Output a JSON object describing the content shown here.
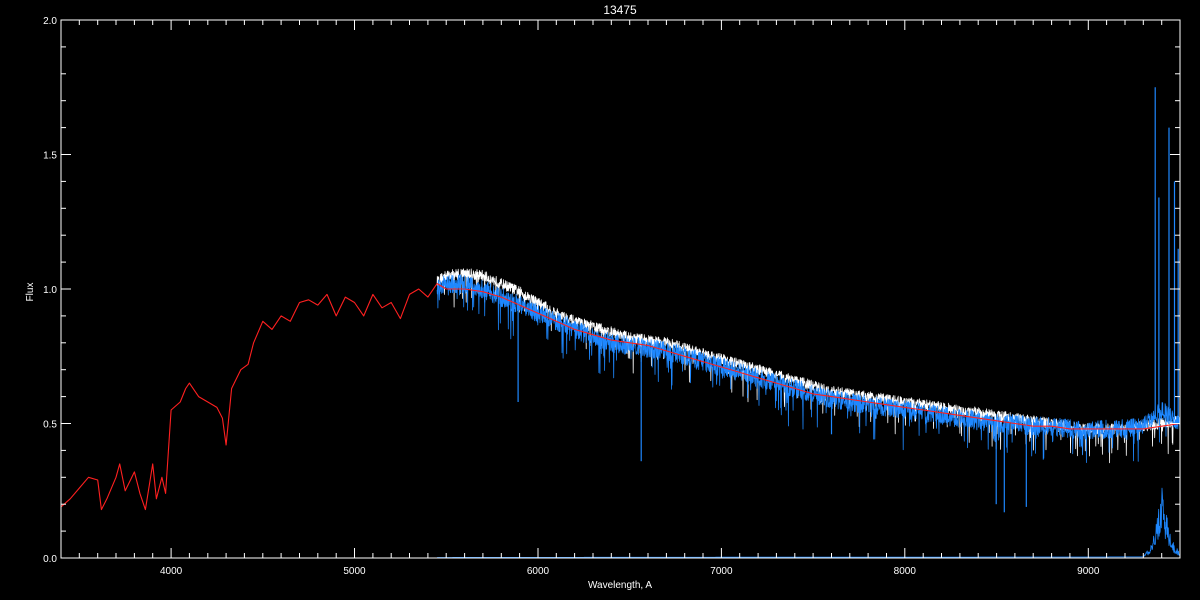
{
  "chart_data": {
    "type": "line",
    "title": "13475",
    "xlabel": "Wavelength, A",
    "ylabel": "Flux",
    "xlim": [
      3400,
      9500
    ],
    "ylim": [
      0.0,
      2.0
    ],
    "x_major_ticks": [
      4000,
      5000,
      6000,
      7000,
      8000,
      9000
    ],
    "x_minor_step": 100,
    "y_major_ticks": [
      0.0,
      0.5,
      1.0,
      1.5,
      2.0
    ],
    "y_minor_step": 0.1,
    "x_tick_labels": [
      "4000",
      "5000",
      "6000",
      "7000",
      "8000",
      "9000"
    ],
    "y_tick_labels": [
      "0.0",
      "0.5",
      "1.0",
      "1.5",
      "2.0"
    ],
    "grid": false,
    "background": "#000000",
    "axis_color": "#ffffff",
    "series": [
      {
        "color": "#ffffff",
        "style": "noisy",
        "noise": 0.02,
        "x": [
          5450,
          5500,
          5600,
          5700,
          5800,
          5900,
          6000,
          6100,
          6200,
          6300,
          6400,
          6500,
          6600,
          6700,
          6800,
          6900,
          7000,
          7100,
          7200,
          7300,
          7400,
          7500,
          7600,
          7700,
          7800,
          7900,
          8000,
          8100,
          8200,
          8300,
          8400,
          8500,
          8600,
          8700,
          8800,
          8900,
          9000,
          9100,
          9200,
          9300,
          9400,
          9500
        ],
        "y": [
          1.03,
          1.05,
          1.06,
          1.05,
          1.02,
          0.99,
          0.95,
          0.91,
          0.88,
          0.86,
          0.84,
          0.82,
          0.81,
          0.8,
          0.78,
          0.76,
          0.74,
          0.72,
          0.7,
          0.68,
          0.66,
          0.64,
          0.62,
          0.61,
          0.6,
          0.59,
          0.58,
          0.57,
          0.56,
          0.55,
          0.54,
          0.53,
          0.52,
          0.51,
          0.5,
          0.49,
          0.48,
          0.48,
          0.48,
          0.49,
          0.5,
          0.51
        ]
      },
      {
        "color": "#1e88ff",
        "style": "noisy",
        "noise": 0.035,
        "x": [
          5450,
          5500,
          5600,
          5700,
          5800,
          5900,
          6000,
          6100,
          6200,
          6300,
          6400,
          6500,
          6600,
          6700,
          6800,
          6900,
          7000,
          7100,
          7200,
          7300,
          7400,
          7500,
          7600,
          7700,
          7800,
          7900,
          8000,
          8100,
          8200,
          8300,
          8400,
          8500,
          8600,
          8700,
          8800,
          8900,
          9000,
          9100,
          9200,
          9300,
          9400,
          9500
        ],
        "y": [
          1.0,
          1.02,
          1.02,
          1.0,
          0.97,
          0.94,
          0.91,
          0.88,
          0.85,
          0.82,
          0.8,
          0.79,
          0.78,
          0.77,
          0.75,
          0.73,
          0.71,
          0.69,
          0.67,
          0.65,
          0.63,
          0.61,
          0.59,
          0.58,
          0.57,
          0.56,
          0.55,
          0.54,
          0.53,
          0.52,
          0.51,
          0.5,
          0.5,
          0.49,
          0.49,
          0.48,
          0.47,
          0.48,
          0.48,
          0.49,
          0.55,
          0.5
        ]
      },
      {
        "color": "#ff2020",
        "style": "line",
        "x": [
          3400,
          3450,
          3500,
          3550,
          3600,
          3620,
          3650,
          3700,
          3720,
          3750,
          3800,
          3830,
          3860,
          3900,
          3920,
          3950,
          3970,
          4000,
          4050,
          4080,
          4100,
          4150,
          4200,
          4250,
          4280,
          4300,
          4330,
          4380,
          4420,
          4450,
          4500,
          4550,
          4600,
          4650,
          4700,
          4750,
          4800,
          4850,
          4900,
          4950,
          5000,
          5050,
          5100,
          5150,
          5200,
          5250,
          5300,
          5350,
          5400,
          5450,
          5500,
          5600,
          5700,
          5800,
          5900,
          6000,
          6100,
          6200,
          6300,
          6400,
          6500,
          6600,
          6700,
          6800,
          6900,
          7000,
          7100,
          7200,
          7300,
          7400,
          7500,
          7600,
          7700,
          7800,
          7900,
          8000,
          8100,
          8200,
          8300,
          8400,
          8500,
          8600,
          8700,
          8800,
          8900,
          9000,
          9100,
          9200,
          9300,
          9400,
          9500
        ],
        "y": [
          0.19,
          0.22,
          0.26,
          0.3,
          0.29,
          0.18,
          0.22,
          0.3,
          0.35,
          0.25,
          0.32,
          0.24,
          0.18,
          0.35,
          0.22,
          0.3,
          0.24,
          0.55,
          0.58,
          0.63,
          0.65,
          0.6,
          0.58,
          0.56,
          0.52,
          0.42,
          0.63,
          0.7,
          0.72,
          0.8,
          0.88,
          0.85,
          0.9,
          0.88,
          0.95,
          0.96,
          0.94,
          0.98,
          0.9,
          0.97,
          0.95,
          0.9,
          0.98,
          0.93,
          0.95,
          0.89,
          0.98,
          1.0,
          0.97,
          1.02,
          1.0,
          1.0,
          0.99,
          0.97,
          0.94,
          0.91,
          0.88,
          0.85,
          0.83,
          0.81,
          0.8,
          0.79,
          0.77,
          0.75,
          0.73,
          0.71,
          0.69,
          0.67,
          0.65,
          0.63,
          0.61,
          0.6,
          0.59,
          0.58,
          0.57,
          0.56,
          0.55,
          0.54,
          0.53,
          0.52,
          0.51,
          0.5,
          0.49,
          0.49,
          0.48,
          0.48,
          0.48,
          0.48,
          0.48,
          0.49,
          0.5
        ]
      },
      {
        "color": "#1e88ff",
        "style": "baseline",
        "x": [
          5450,
          9300,
          9350,
          9400,
          9450,
          9500
        ],
        "y": [
          0.002,
          0.004,
          0.03,
          0.15,
          0.04,
          0.01
        ]
      }
    ],
    "spikes": [
      {
        "x": 5892,
        "y": 0.58,
        "color": "#1e88ff"
      },
      {
        "x": 6563,
        "y": 0.36,
        "color": "#1e88ff"
      },
      {
        "x": 8498,
        "y": 0.2,
        "color": "#1e88ff"
      },
      {
        "x": 8542,
        "y": 0.17,
        "color": "#1e88ff"
      },
      {
        "x": 8662,
        "y": 0.19,
        "color": "#1e88ff"
      },
      {
        "x": 7600,
        "y": 0.46,
        "color": "#1e88ff"
      },
      {
        "x": 9365,
        "y": 1.75,
        "color": "#1e88ff"
      },
      {
        "x": 9385,
        "y": 1.34,
        "color": "#1e88ff"
      },
      {
        "x": 9440,
        "y": 1.6,
        "color": "#1e88ff"
      },
      {
        "x": 9470,
        "y": 1.4,
        "color": "#1e88ff"
      },
      {
        "x": 9490,
        "y": 1.15,
        "color": "#1e88ff"
      }
    ]
  }
}
